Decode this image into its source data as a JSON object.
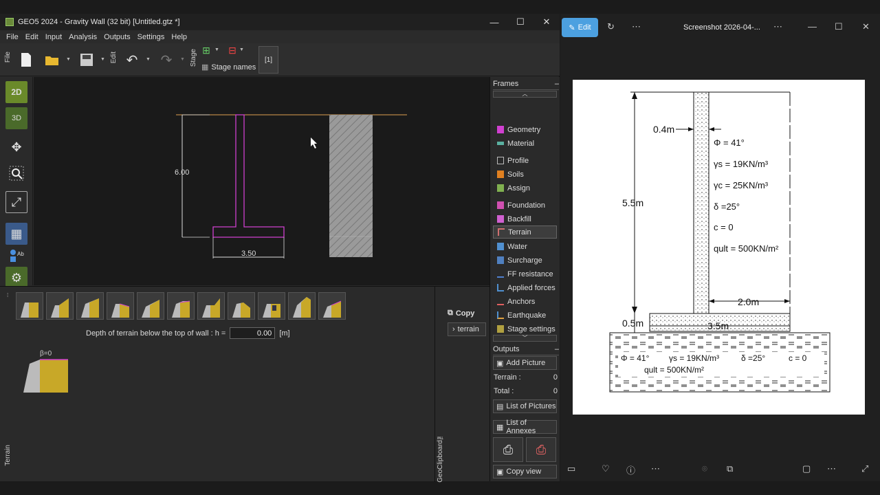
{
  "geo": {
    "window_title": "GEO5 2024 - Gravity Wall (32 bit) [Untitled.gtz *]",
    "menu": [
      "File",
      "Edit",
      "Input",
      "Analysis",
      "Outputs",
      "Settings",
      "Help"
    ],
    "toolbar": {
      "file_label": "File",
      "edit_label": "Edit",
      "stage_label": "Stage",
      "stage_names_label": "Stage names",
      "stage_number": "[1]"
    },
    "left_tools": {
      "mode_2d": "2D",
      "mode_3d": "3D"
    },
    "canvas": {
      "dim_height": "6.00",
      "dim_width": "3.50"
    },
    "terrain_panel": {
      "beta_label": "β=0",
      "depth_label": "Depth of terrain below the top of wall : h =",
      "depth_value": "0.00",
      "depth_unit": "[m]",
      "side_label": "Terrain"
    },
    "clipboard": {
      "copy_label": "Copy",
      "terrain_label": "terrain",
      "side_label": "GeoClipboard™"
    },
    "frames": {
      "header": "Frames",
      "items": [
        {
          "label": "Geometry",
          "color": "#d040d0"
        },
        {
          "label": "Material",
          "color": "#5ab0a0"
        },
        {
          "label": "Profile",
          "color": "#bbbbbb"
        },
        {
          "label": "Soils",
          "color": "#e08020"
        },
        {
          "label": "Assign",
          "color": "#80b050"
        },
        {
          "label": "Foundation",
          "color": "#d050b0"
        },
        {
          "label": "Backfill",
          "color": "#d060d0"
        },
        {
          "label": "Terrain",
          "color": "#d07070"
        },
        {
          "label": "Water",
          "color": "#5090d0"
        },
        {
          "label": "Surcharge",
          "color": "#5080c0"
        },
        {
          "label": "FF resistance",
          "color": "#5080d0"
        },
        {
          "label": "Applied forces",
          "color": "#5090d0"
        },
        {
          "label": "Anchors",
          "color": "#e06060"
        },
        {
          "label": "Earthquake",
          "color": "#e0a040"
        },
        {
          "label": "Stage settings",
          "color": "#b0a040"
        }
      ],
      "active": "Terrain"
    },
    "outputs": {
      "header": "Outputs",
      "add_picture": "Add Picture",
      "terrain_count_label": "Terrain :",
      "terrain_count": "0",
      "total_label": "Total :",
      "total_count": "0",
      "list_pictures": "List of Pictures",
      "list_annexes": "List of Annexes",
      "copy_view": "Copy view"
    }
  },
  "photos": {
    "edit_label": "Edit",
    "title": "Screenshot 2026-04-...",
    "sketch": {
      "wall_thickness": "0.4m",
      "wall_height": "5.5m",
      "phi": "Φ = 41°",
      "gamma_s": "γs = 19KN/m³",
      "gamma_c": "γc = 25KN/m³",
      "delta": "δ =25°",
      "c": "c = 0",
      "q_ult": "qult = 500KN/m²",
      "heel_width": "2.0m",
      "base_thickness": "0.5m",
      "base_width": "3.5m",
      "found_phi": "Φ = 41°",
      "found_gamma": "γs = 19KN/m³",
      "found_delta": "δ =25°",
      "found_c": "c = 0",
      "found_qult": "qult = 500KN/m²"
    }
  }
}
